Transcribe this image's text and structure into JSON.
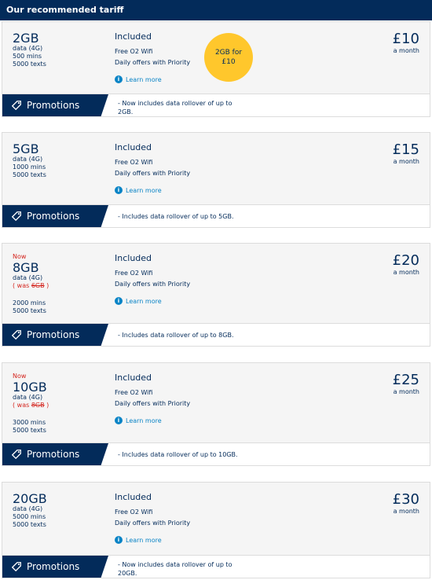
{
  "header": {
    "title": "Our recommended tariff"
  },
  "promo_label": "Promotions",
  "included_label": "Included",
  "learn_more_label": "Learn more",
  "perks": [
    "Free O2 Wifi",
    "Daily offers with Priority"
  ],
  "month_label": "a month",
  "tariffs": [
    {
      "data": "2GB",
      "data_type": "data (4G)",
      "mins": "500 mins",
      "texts": "5000 texts",
      "price": "£10",
      "badge": "2GB for £10",
      "promo_text": "- Now includes data rollover of up to 2GB."
    },
    {
      "data": "5GB",
      "data_type": "data (4G)",
      "mins": "1000 mins",
      "texts": "5000 texts",
      "price": "£15",
      "promo_text": "- Includes data rollover of up to 5GB."
    },
    {
      "now": "Now",
      "data": "8GB",
      "data_type": "data (4G)",
      "was_prefix": "( was",
      "was_value": "6GB",
      "was_suffix": ")",
      "mins": "2000 mins",
      "texts": "5000 texts",
      "price": "£20",
      "promo_text": "- Includes data rollover of up to 8GB."
    },
    {
      "now": "Now",
      "data": "10GB",
      "data_type": "data (4G)",
      "was_prefix": "( was",
      "was_value": "8GB",
      "was_suffix": ")",
      "mins": "3000 mins",
      "texts": "5000 texts",
      "price": "£25",
      "promo_text": "- Includes data rollover of up to 10GB."
    },
    {
      "data": "20GB",
      "data_type": "data (4G)",
      "mins": "5000 mins",
      "texts": "5000 texts",
      "price": "£30",
      "promo_text": "- Now includes data rollover of up to 20GB."
    }
  ]
}
